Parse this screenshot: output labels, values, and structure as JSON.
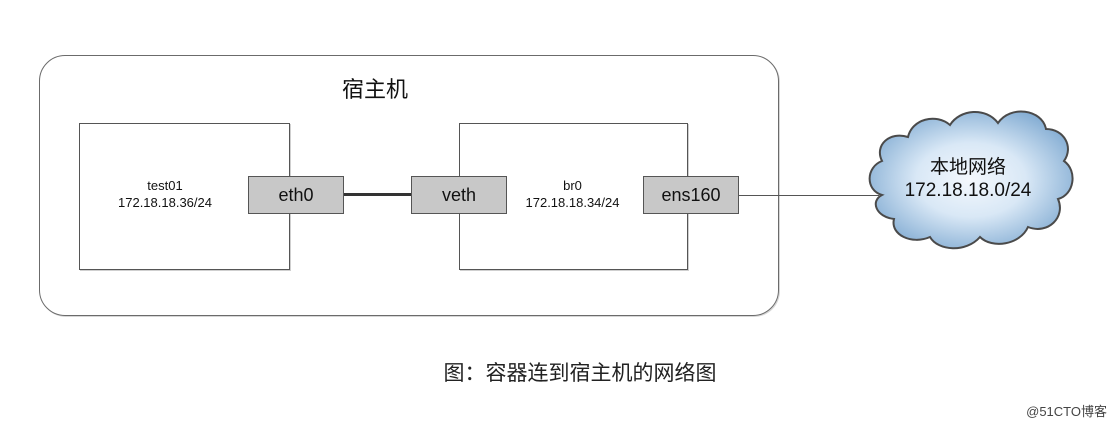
{
  "host": {
    "title": "宿主机"
  },
  "container": {
    "name": "test01",
    "ip": "172.18.18.36/24",
    "interface": "eth0"
  },
  "bridge": {
    "name": "br0",
    "ip": "172.18.18.34/24",
    "interface": "veth",
    "uplink": "ens160"
  },
  "network": {
    "name": "本地网络",
    "subnet": "172.18.18.0/24"
  },
  "caption": "图：容器连到宿主机的网络图",
  "watermark": "@51CTO博客",
  "colors": {
    "interface_fill": "#c8c8c8",
    "cloud_light": "#eef5fc",
    "cloud_dark": "#7aa6cf"
  }
}
